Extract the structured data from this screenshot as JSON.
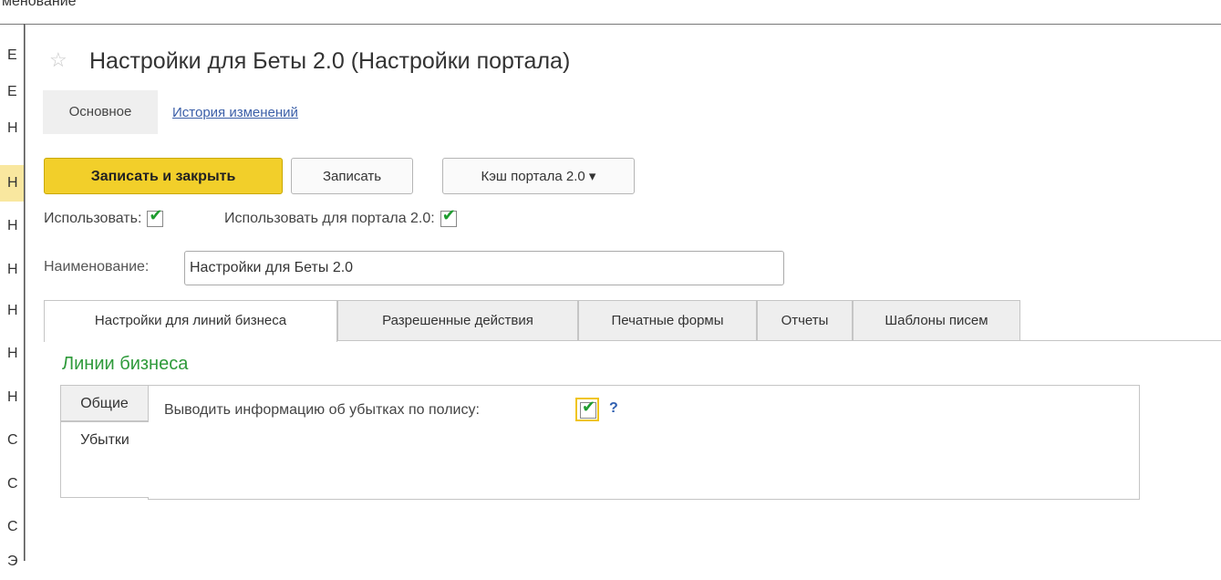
{
  "background": {
    "header_text": "менование",
    "rows": [
      "Е",
      "Е",
      "Н",
      "Н",
      "Н",
      "Н",
      "Н",
      "Н",
      "Н",
      "С",
      "С",
      "С",
      "Э"
    ]
  },
  "dialog": {
    "title": "Настройки для Беты 2.0 (Настройки портала)",
    "star_icon": "star-outline-icon",
    "nav": {
      "main": "Основное",
      "history": "История изменений"
    },
    "toolbar": {
      "save_close": "Записать и закрыть",
      "save": "Записать",
      "cache": "Кэш портала 2.0 ▾"
    },
    "use_label": "Использовать:",
    "use_checked": true,
    "use_portal_label": "Использовать для портала 2.0:",
    "use_portal_checked": true,
    "name_label": "Наименование:",
    "name_value": "Настройки для Беты 2.0",
    "tabs": [
      "Настройки для линий бизнеса",
      "Разрешенные действия",
      "Печатные формы",
      "Отчеты",
      "Шаблоны писем"
    ],
    "section_title": "Линии бизнеса",
    "vtabs": [
      "Общие",
      "Убытки"
    ],
    "option_label": "Выводить информацию об убытках по полису:",
    "option_checked": true,
    "help": "?",
    "colors": {
      "primary_button": "#f2cf2a",
      "section_title": "#2e9a3a",
      "link": "#3b5fa8",
      "checkmark": "#1e9c2f"
    }
  }
}
